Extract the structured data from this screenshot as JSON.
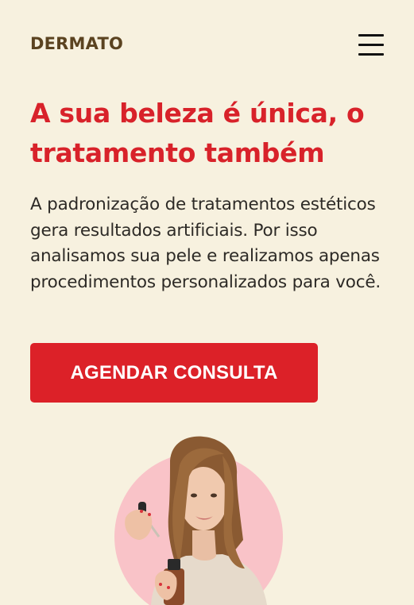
{
  "header": {
    "logo": "DERMATO",
    "menu_icon": "hamburger-menu-icon"
  },
  "hero": {
    "title": "A sua beleza é única, o tratamento também",
    "description": "A padronização de tratamentos estéticos gera resultados artificiais. Por isso analisamos sua pele e realizamos apenas procedimentos personalizados para você.",
    "cta_label": "AGENDAR CONSULTA"
  },
  "colors": {
    "background": "#F7F1DF",
    "accent": "#D8222A",
    "logo": "#5B4320",
    "button": "#DC2128",
    "circle": "#F9C3C8"
  }
}
